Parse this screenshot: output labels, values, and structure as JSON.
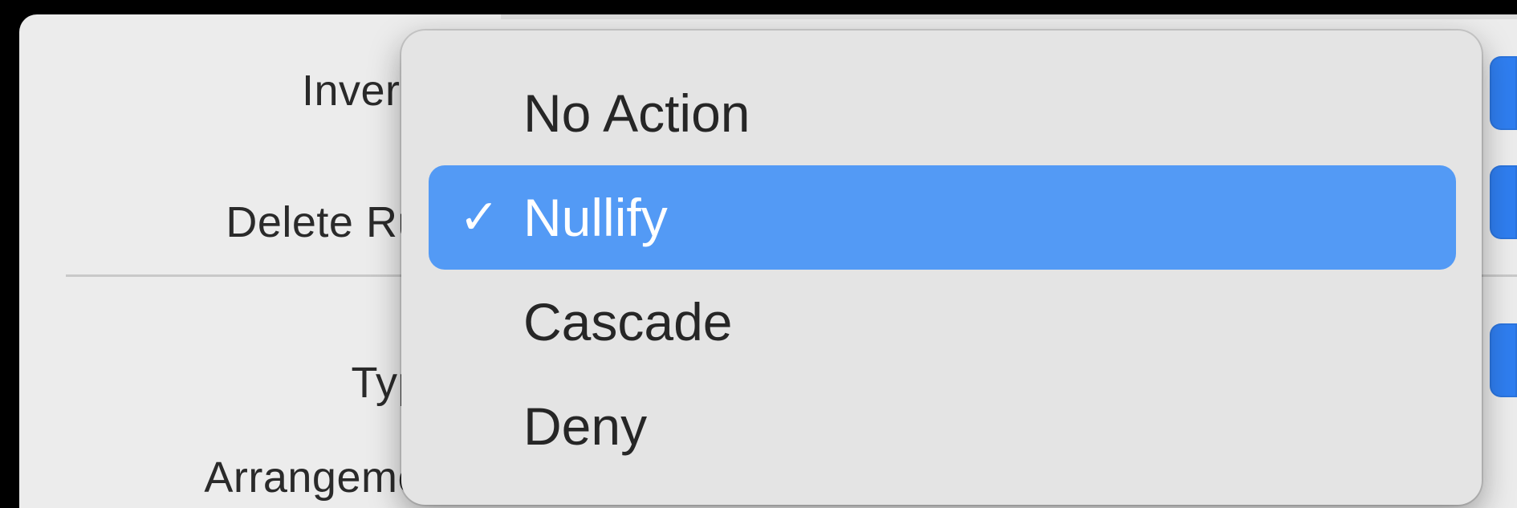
{
  "panel": {
    "labels": {
      "inverse": "Invers",
      "delete_rule": "Delete Ru",
      "type": "Typ",
      "arrangement": "Arrangeme"
    }
  },
  "menu": {
    "items": [
      {
        "label": "No Action",
        "checked": false,
        "check_glyph": ""
      },
      {
        "label": "Nullify",
        "checked": true,
        "check_glyph": "✓"
      },
      {
        "label": "Cascade",
        "checked": false,
        "check_glyph": ""
      },
      {
        "label": "Deny",
        "checked": false,
        "check_glyph": ""
      }
    ],
    "selected_index": 1,
    "highlight_color": "#539af5"
  },
  "colors": {
    "panel_bg": "#ececec",
    "menu_bg": "#e4e4e4",
    "accent": "#2f7ef0"
  }
}
